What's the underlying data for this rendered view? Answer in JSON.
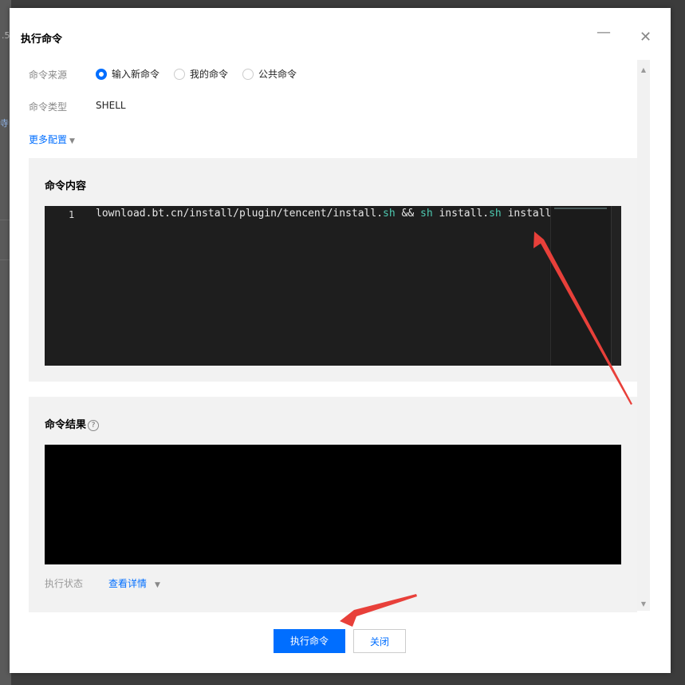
{
  "backdrop": {
    "text1": ".5",
    "text2": "寺"
  },
  "dialog": {
    "title": "执行命令",
    "minimize_glyph": "—",
    "close_glyph": "✕"
  },
  "form": {
    "source_label": "命令来源",
    "source_options": [
      {
        "label": "输入新命令",
        "checked": true
      },
      {
        "label": "我的命令",
        "checked": false
      },
      {
        "label": "公共命令",
        "checked": false
      }
    ],
    "type_label": "命令类型",
    "type_value": "SHELL",
    "more_config": "更多配置"
  },
  "content_panel": {
    "title": "命令内容",
    "line_number": "1",
    "code_segments": [
      {
        "text": "lownload.bt.cn/install/plugin/tencent/install.",
        "kw": false
      },
      {
        "text": "sh",
        "kw": true
      },
      {
        "text": " && ",
        "kw": false
      },
      {
        "text": "sh",
        "kw": true
      },
      {
        "text": " install.",
        "kw": false
      },
      {
        "text": "sh",
        "kw": true
      },
      {
        "text": " install",
        "kw": false
      }
    ]
  },
  "result_panel": {
    "title": "命令结果",
    "help_glyph": "?",
    "status_label": "执行状态",
    "detail_link": "查看详情"
  },
  "footer": {
    "execute_label": "执行命令",
    "close_label": "关闭"
  },
  "colors": {
    "primary": "#006eff",
    "annotation_arrow": "#e8403a",
    "editor_bg": "#1e1e1e",
    "keyword": "#4ec9b0"
  }
}
